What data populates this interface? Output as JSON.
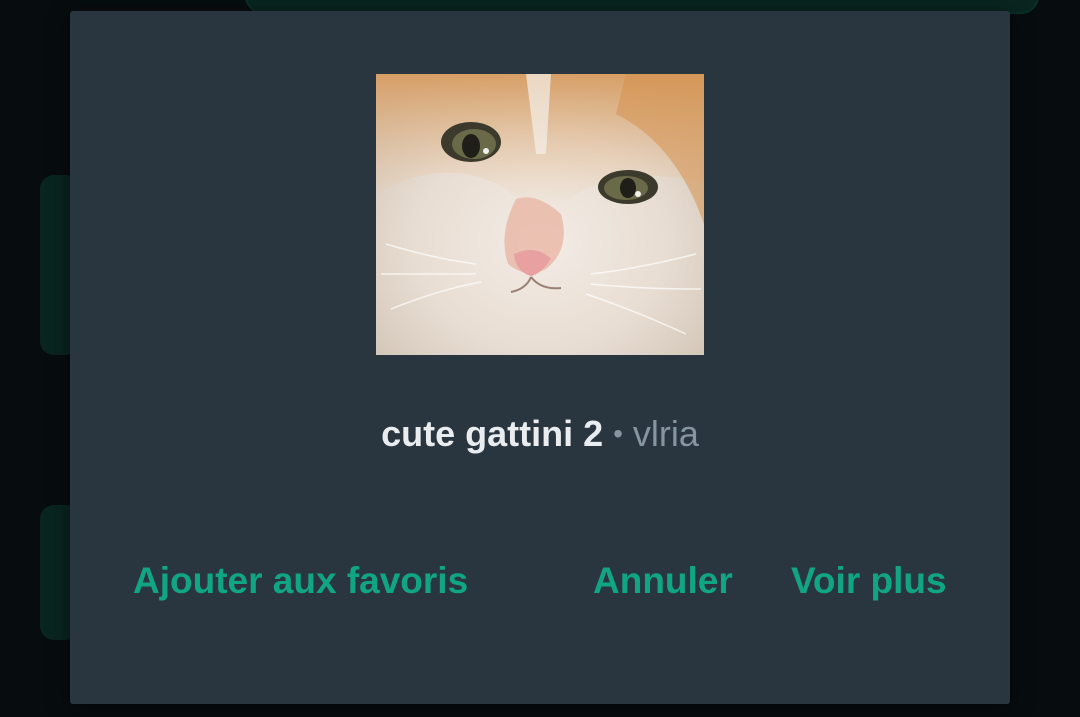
{
  "sticker_dialog": {
    "sticker_image": "crying-cat-sticker",
    "pack_name": "cute gattini 2",
    "separator": "•",
    "author": "vlria",
    "actions": {
      "add_favorite_label": "Ajouter aux favoris",
      "cancel_label": "Annuler",
      "see_more_label": "Voir plus"
    }
  },
  "colors": {
    "dialog_bg": "#29363f",
    "accent": "#11a683",
    "primary_text": "#e9edef",
    "secondary_text": "#8696a0"
  }
}
